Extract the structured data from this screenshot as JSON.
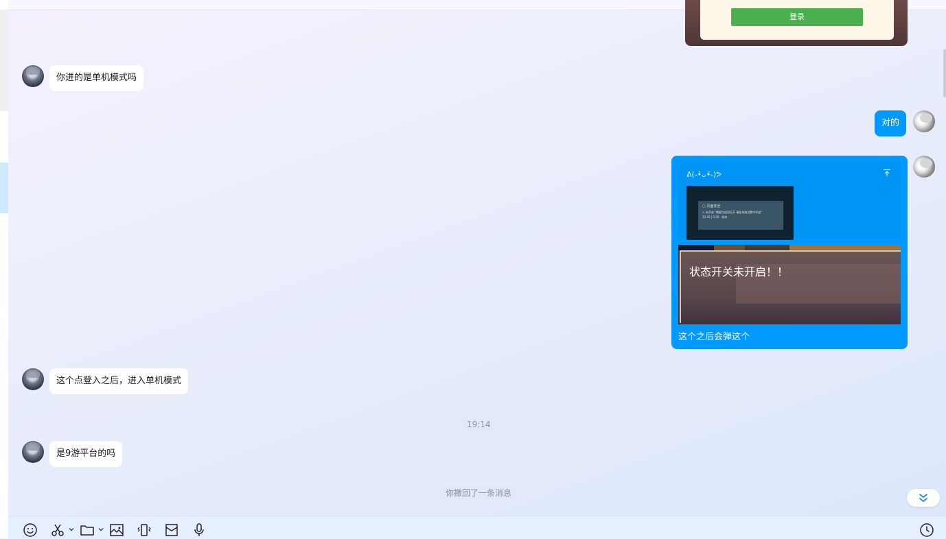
{
  "image_card": {
    "button_label": "登录"
  },
  "messages": [
    {
      "side": "left",
      "text": "你进的是单机模式吗"
    },
    {
      "side": "right",
      "text": "对的"
    },
    {
      "side": "left",
      "text": "这个点登入之后，进入单机模式"
    },
    {
      "side": "left",
      "text": "是9游平台的吗"
    }
  ],
  "reply": {
    "quoted_name": "ᕕ(˵•̀ᴗ•́˵)ᕗ",
    "thumb_title": "▢ 页面安全",
    "thumb_line1": "⚠ 未开启 \"需要为应用打开 请在系统设置中开启\"",
    "thumb_line2": "22:45 | 0:30 · 结束",
    "thumb_close": "✕",
    "game_text": "状态开关未开启！！",
    "caption": "这个之后会弹这个"
  },
  "time_divider": "19:14",
  "system_notice": "你撤回了一条消息",
  "toolbar": {
    "icons": [
      "emoji-icon",
      "scissors-icon",
      "folder-icon",
      "image-icon",
      "shake-icon",
      "red-packet-icon",
      "microphone-icon",
      "history-clock-icon"
    ]
  },
  "colors": {
    "bubble_self": "#0099ff",
    "bubble_other": "#ffffff",
    "login_green": "#4caf50"
  }
}
